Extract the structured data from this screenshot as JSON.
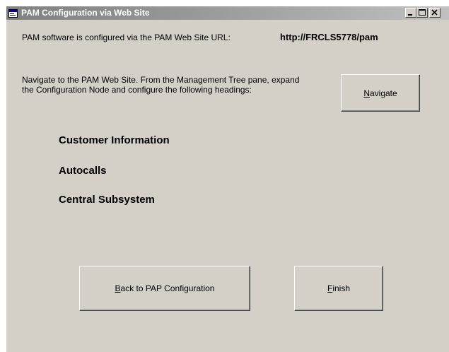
{
  "window": {
    "title": "PAM Configuration via Web Site"
  },
  "info": {
    "configured_label": "PAM software is configured via the PAM Web Site URL:",
    "url": "http://FRCLS5778/pam",
    "instructions": "Navigate to the PAM Web Site. From the Management Tree pane, expand the Configuration Node and configure the following headings:"
  },
  "headings": [
    "Customer Information",
    "Autocalls",
    "Central Subsystem"
  ],
  "buttons": {
    "navigate": {
      "mnemonic": "N",
      "rest": "avigate"
    },
    "back": {
      "mnemonic": "B",
      "rest": "ack to PAP Configuration"
    },
    "finish": {
      "mnemonic": "F",
      "rest": "inish"
    }
  },
  "icons": {
    "window": "window-icon",
    "minimize": "minimize-icon",
    "maximize": "maximize-icon",
    "close": "close-icon"
  },
  "colors": {
    "face": "#d4d0c8",
    "title_inactive_start": "#808080",
    "title_inactive_end": "#c0c0c0"
  }
}
